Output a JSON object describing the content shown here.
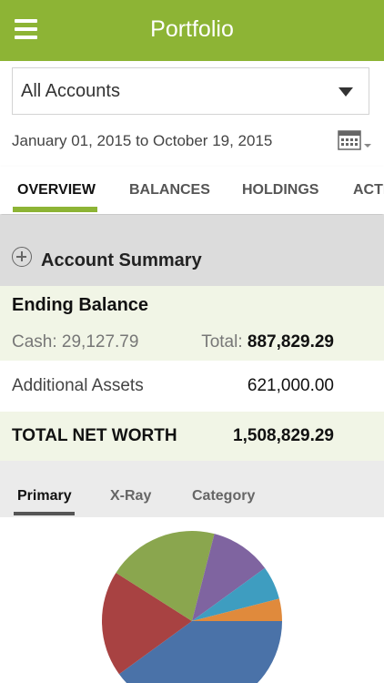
{
  "header": {
    "title": "Portfolio",
    "menu_icon": "hamburger-menu-icon"
  },
  "account_selector": {
    "value": "All Accounts",
    "icon": "dropdown-caret-icon"
  },
  "date_range": {
    "text": "January 01, 2015 to October 19, 2015",
    "icon": "calendar-icon"
  },
  "tabs": [
    {
      "label": "OVERVIEW",
      "active": true
    },
    {
      "label": "BALANCES",
      "active": false
    },
    {
      "label": "HOLDINGS",
      "active": false
    },
    {
      "label": "ACTI",
      "active": false
    }
  ],
  "summary": {
    "title": "Account Summary",
    "expand_icon": "plus-circle-icon",
    "ending_balance_label": "Ending Balance",
    "cash_text": "Cash: 29,127.79",
    "total_label": "Total:",
    "total_value": "887,829.29",
    "additional_assets_label": "Additional Assets",
    "additional_assets_value": "621,000.00",
    "net_worth_label": "TOTAL NET WORTH",
    "net_worth_value": "1,508,829.29"
  },
  "chart_tabs": [
    {
      "label": "Primary",
      "active": true
    },
    {
      "label": "X-Ray",
      "active": false
    },
    {
      "label": "Category",
      "active": false
    }
  ],
  "colors": {
    "brand": "#8db435",
    "slices": [
      "#4a72a8",
      "#a84242",
      "#8aa64e",
      "#7f64a0",
      "#3e9dc0",
      "#e08a3c"
    ]
  },
  "chart_data": {
    "type": "pie",
    "slices": [
      {
        "value": 0.4
      },
      {
        "value": 0.19
      },
      {
        "value": 0.2
      },
      {
        "value": 0.11
      },
      {
        "value": 0.06
      },
      {
        "value": 0.04
      }
    ]
  }
}
